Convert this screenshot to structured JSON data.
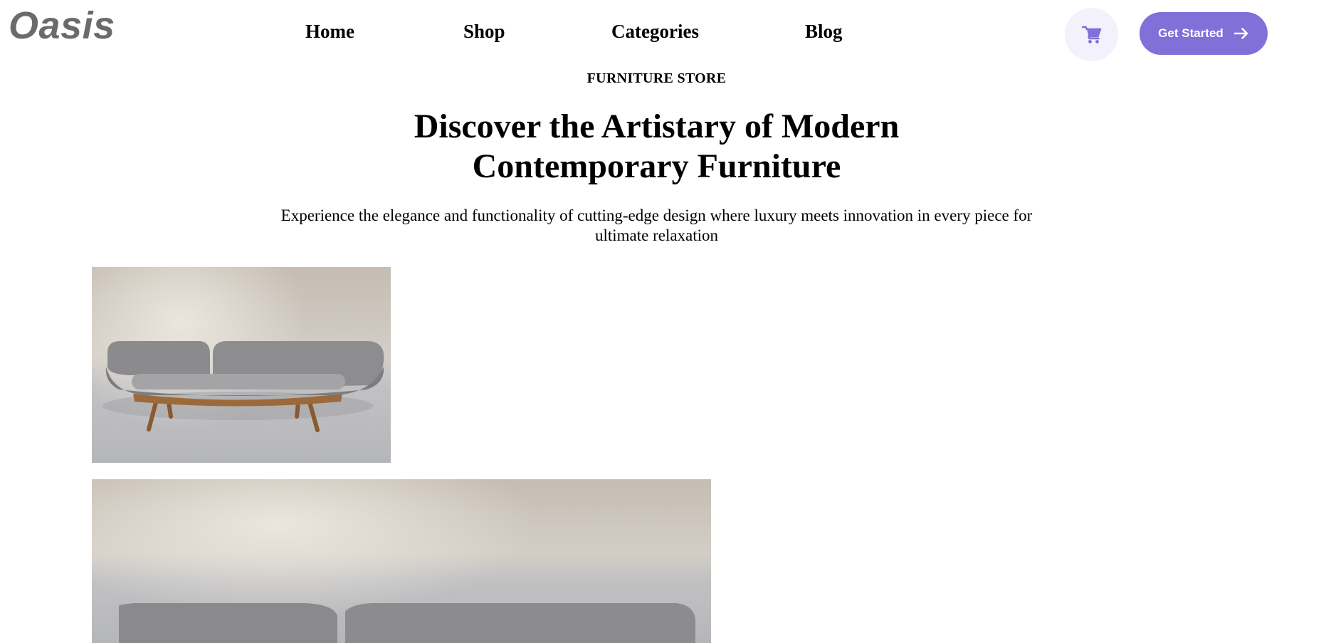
{
  "brand": {
    "logo": "Oasis"
  },
  "nav": {
    "items": [
      {
        "label": "Home"
      },
      {
        "label": "Shop"
      },
      {
        "label": "Categories"
      },
      {
        "label": "Blog"
      }
    ]
  },
  "header": {
    "cart_icon": "cart-icon",
    "cta_label": "Get Started",
    "cta_icon": "arrow-right-icon"
  },
  "hero": {
    "eyebrow": "FURNITURE STORE",
    "title_line1": "Discover the Artistary of Modern",
    "title_line2": "Contemporary Furniture",
    "description": "Experience the elegance and functionality of cutting-edge design where luxury meets innovation in every piece for ultimate relaxation"
  },
  "images": [
    {
      "subject": "sofa-image"
    },
    {
      "subject": "sofa-image"
    }
  ],
  "colors": {
    "accent": "#8070d8",
    "cart_bg": "#f3f1fb",
    "logo": "#6b6b6b",
    "text": "#000000",
    "background": "#ffffff"
  }
}
